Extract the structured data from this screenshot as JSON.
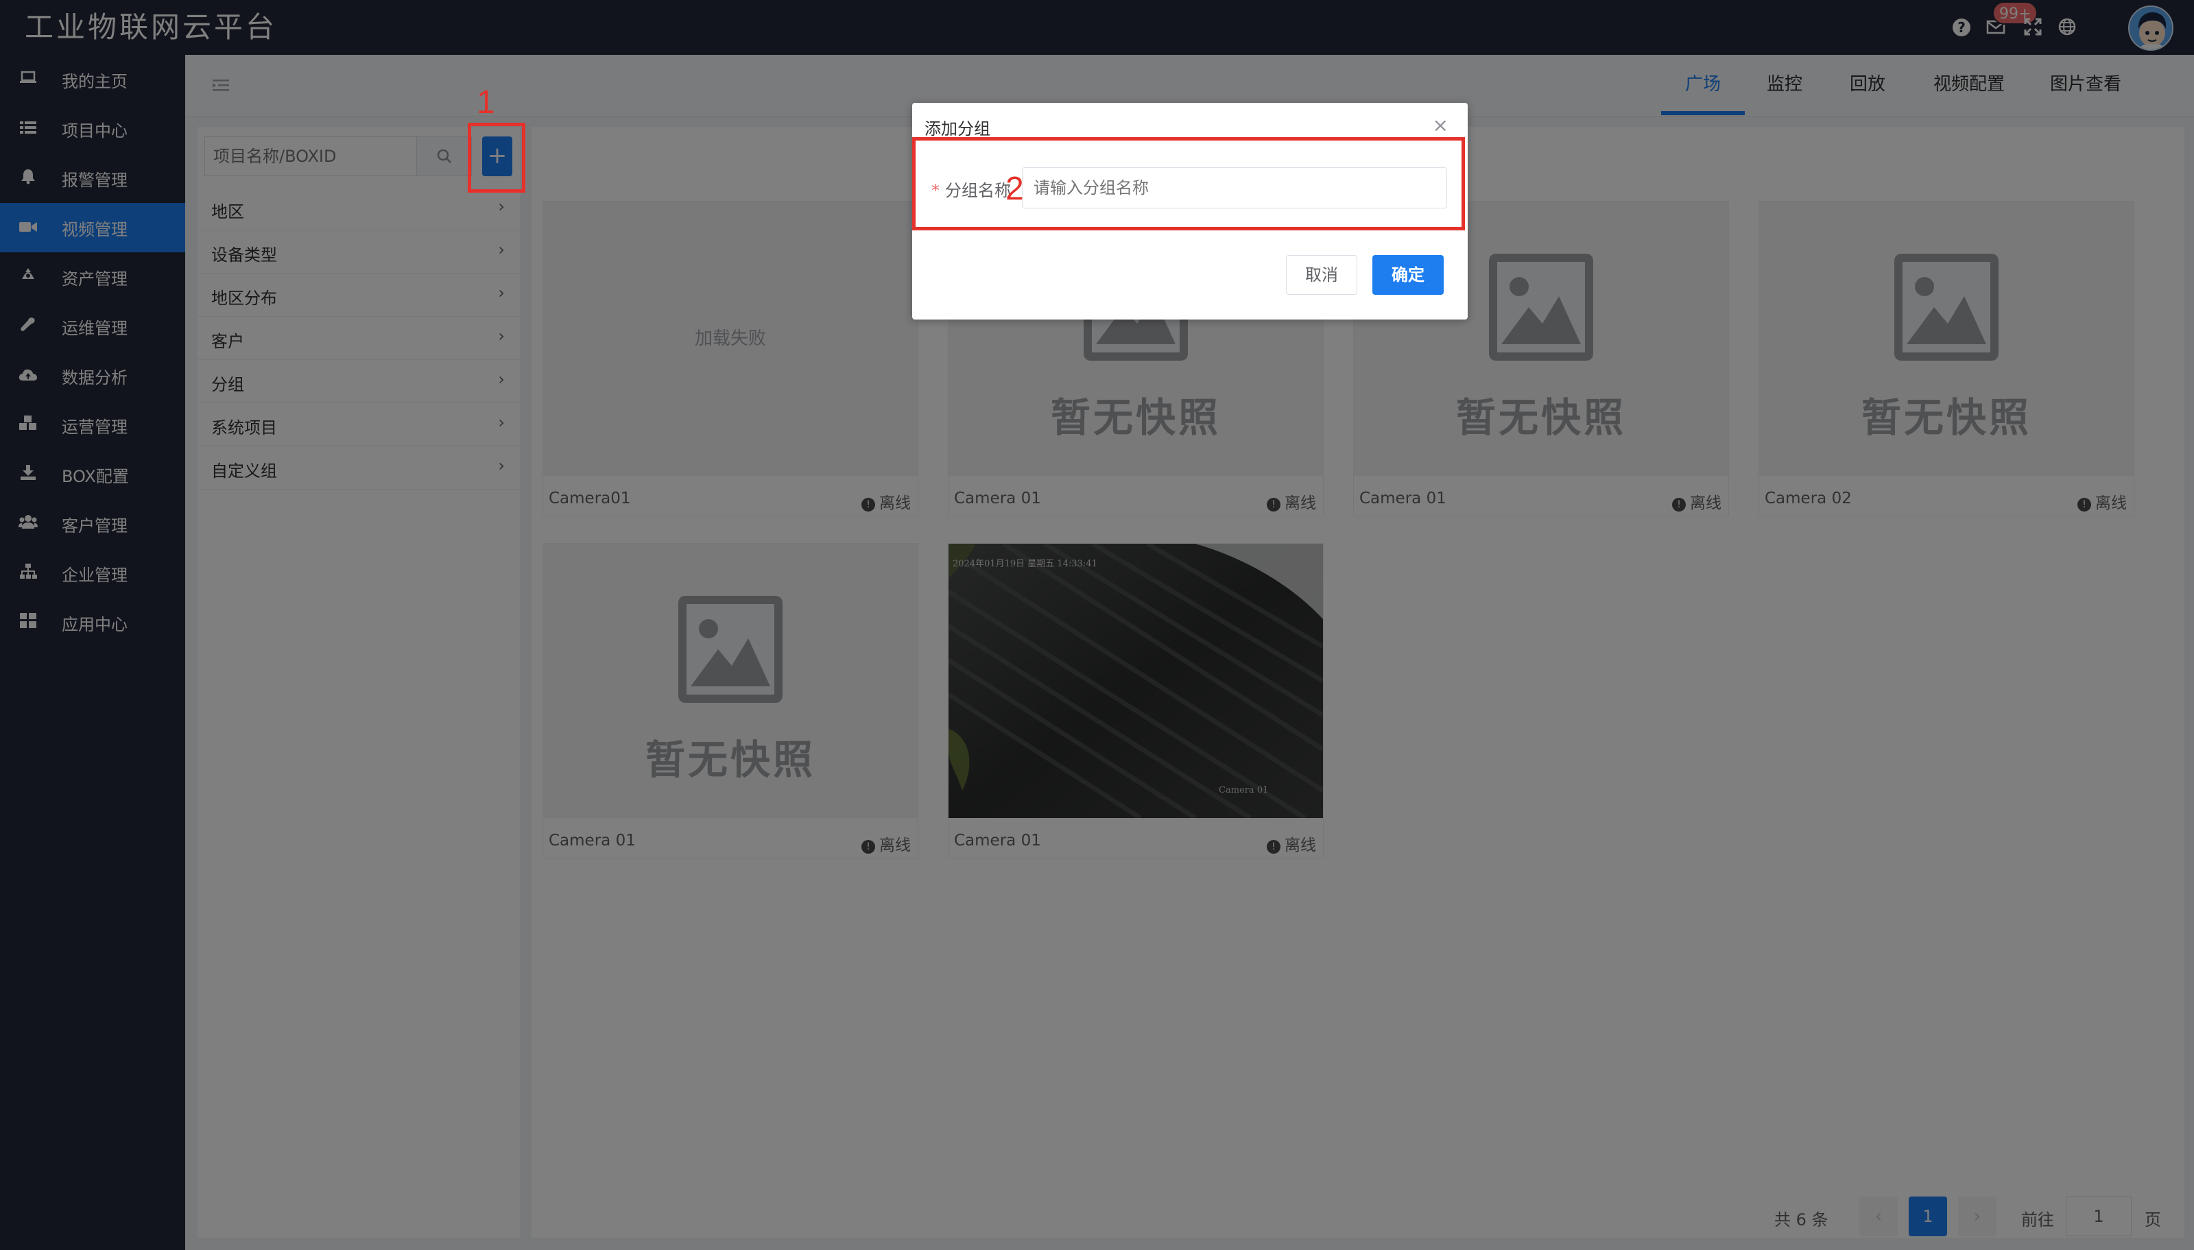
{
  "header": {
    "app_title": "工业物联网云平台",
    "mail_badge": "99+",
    "icons": [
      "help-icon",
      "mail-icon",
      "fullscreen-icon",
      "globe-icon"
    ]
  },
  "sidebar": {
    "items": [
      {
        "label": "我的主页",
        "icon": "laptop-icon"
      },
      {
        "label": "项目中心",
        "icon": "list-icon"
      },
      {
        "label": "报警管理",
        "icon": "bell-icon"
      },
      {
        "label": "视频管理",
        "icon": "video-camera-icon",
        "active": true
      },
      {
        "label": "资产管理",
        "icon": "recycle-icon"
      },
      {
        "label": "运维管理",
        "icon": "wrench-icon"
      },
      {
        "label": "数据分析",
        "icon": "cloud-upload-icon"
      },
      {
        "label": "运营管理",
        "icon": "cubes-icon"
      },
      {
        "label": "BOX配置",
        "icon": "download-icon"
      },
      {
        "label": "客户管理",
        "icon": "users-icon"
      },
      {
        "label": "企业管理",
        "icon": "sitemap-icon"
      },
      {
        "label": "应用中心",
        "icon": "grid-icon"
      }
    ]
  },
  "tabs": [
    {
      "label": "广场",
      "active": true
    },
    {
      "label": "监控"
    },
    {
      "label": "回放"
    },
    {
      "label": "视频配置"
    },
    {
      "label": "图片查看"
    }
  ],
  "leftpanel": {
    "search_placeholder": "项目名称/BOXID",
    "add_label": "+",
    "tree": [
      "地区",
      "设备类型",
      "地区分布",
      "客户",
      "分组",
      "系统项目",
      "自定义组"
    ]
  },
  "cards": [
    {
      "name": "Camera01",
      "status": "离线",
      "thumb": "failed",
      "thumb_text": "加载失败"
    },
    {
      "name": "Camera 01",
      "status": "离线",
      "thumb": "none",
      "thumb_text": "暂无快照"
    },
    {
      "name": "Camera 01",
      "status": "离线",
      "thumb": "none",
      "thumb_text": "暂无快照"
    },
    {
      "name": "Camera 02",
      "status": "离线",
      "thumb": "none",
      "thumb_text": "暂无快照"
    },
    {
      "name": "Camera 01",
      "status": "离线",
      "thumb": "none",
      "thumb_text": "暂无快照"
    },
    {
      "name": "Camera 01",
      "status": "离线",
      "thumb": "snapshot",
      "overlay_top": "2024年01月19日 星期五 14:33:41",
      "overlay_bottom": "Camera 01"
    }
  ],
  "pagination": {
    "total": "共 6 条",
    "prev": "‹",
    "current": "1",
    "next": "›",
    "goto_label": "前往",
    "goto_value": "1",
    "page_suffix": "页"
  },
  "dialog": {
    "title": "添加分组",
    "close": "×",
    "field_required_mark": "*",
    "field_label": "分组名称",
    "field_placeholder": "请输入分组名称",
    "cancel": "取消",
    "confirm": "确定"
  },
  "annotations": [
    "1",
    "2"
  ],
  "colors": {
    "primary": "#1e7ef0",
    "topbar": "#232938",
    "annotation": "#e5312b",
    "badge": "#f56c6c"
  }
}
